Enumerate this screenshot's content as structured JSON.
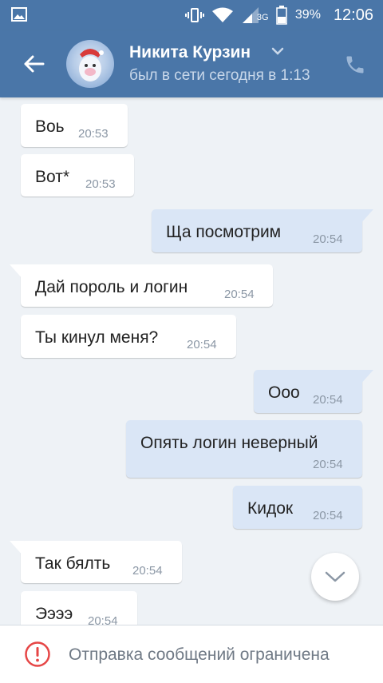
{
  "status_bar": {
    "network": "3G",
    "battery_percent": "39%",
    "time": "12:06"
  },
  "header": {
    "contact_name": "Никита Курзин",
    "last_seen": "был в сети сегодня в 1:13",
    "icons": [
      "back-arrow-icon",
      "chevron-down-icon",
      "phone-icon"
    ]
  },
  "messages": [
    {
      "direction": "in",
      "text": "Воь",
      "time": "20:53"
    },
    {
      "direction": "in",
      "text": "Вот*",
      "time": "20:53"
    },
    {
      "direction": "out",
      "text": "Ща посмотрим",
      "time": "20:54"
    },
    {
      "direction": "in",
      "text": "Дай пороль и логин",
      "time": "20:54"
    },
    {
      "direction": "in",
      "text": "Ты кинул меня?",
      "time": "20:54"
    },
    {
      "direction": "out",
      "text": "Ооо",
      "time": "20:54"
    },
    {
      "direction": "out",
      "text": "Опять логин неверный",
      "time": "20:54"
    },
    {
      "direction": "out",
      "text": "Кидок",
      "time": "20:54"
    },
    {
      "direction": "in",
      "text": "Так бялть",
      "time": "20:54"
    },
    {
      "direction": "in",
      "text": "Ээээ",
      "time": "20:54"
    }
  ],
  "bottom_bar": {
    "restriction_text": "Отправка сообщений ограничена",
    "icon": "alert-circle-icon"
  },
  "colors": {
    "header_bg": "#4a76a8",
    "outgoing_bubble": "#dae6f6",
    "incoming_bubble": "#ffffff",
    "chat_bg": "#eef2f6",
    "alert_red": "#e64646"
  }
}
